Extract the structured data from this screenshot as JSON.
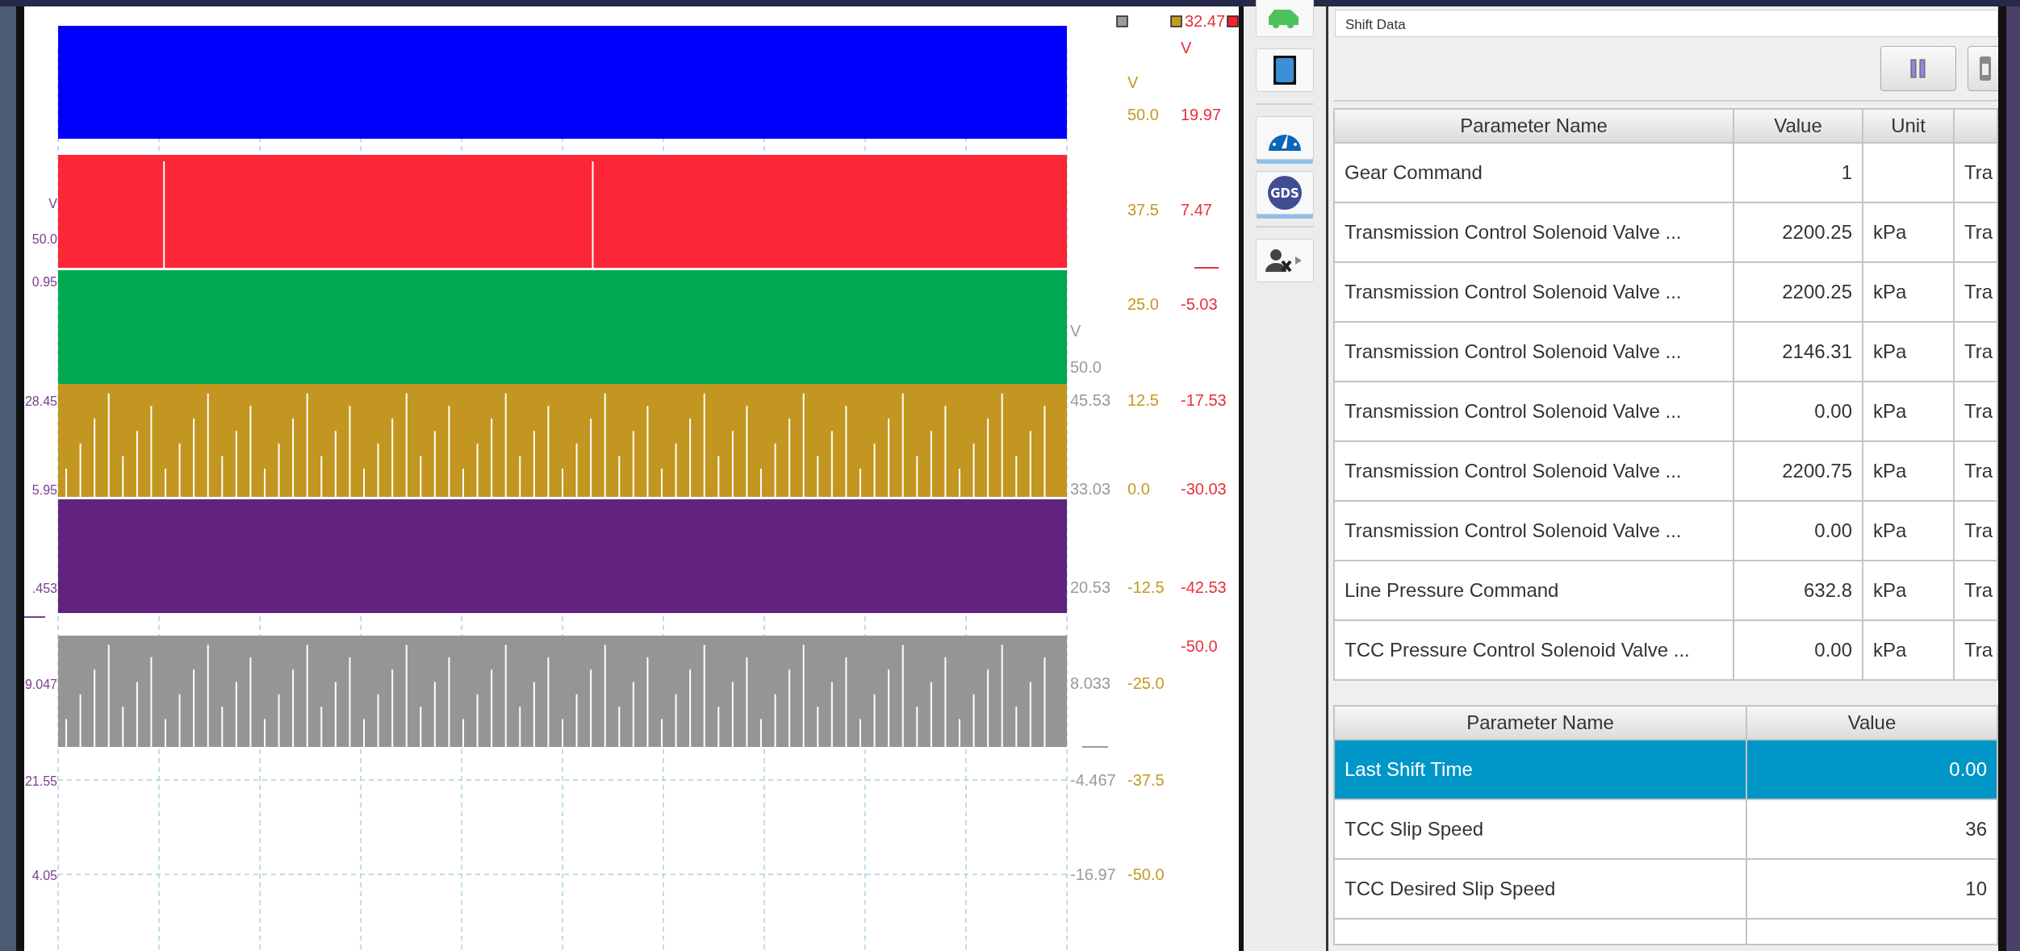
{
  "chart": {
    "legend": [
      {
        "color": "#9a9a9a"
      },
      {
        "color": "#c49a1f"
      },
      {
        "color": "#f0242e"
      }
    ],
    "traces": [
      {
        "color": "#0000ff",
        "kind": "plain"
      },
      {
        "color": "#fb2636",
        "kind": "sparse"
      },
      {
        "color": "#00a84f",
        "kind": "plain"
      },
      {
        "color": "#c29620",
        "kind": "dense"
      },
      {
        "color": "#61237e",
        "kind": "plain"
      },
      {
        "color": "#959595",
        "kind": "dense"
      }
    ],
    "axes": [
      {
        "color": "#7a3f8a",
        "labels": [
          "V",
          "50.0",
          "0.95",
          "28.45",
          "5.95",
          ".453",
          "9.047",
          "21.55",
          "4.05"
        ]
      },
      {
        "color": "#9a9a9a",
        "labels": [
          "V",
          "50.0",
          "45.53",
          "33.03",
          "20.53",
          "8.033",
          "-4.467",
          "-16.97"
        ]
      },
      {
        "color": "#c49a1f",
        "labels": [
          "V",
          "50.0",
          "37.5",
          "25.0",
          "12.5",
          "0.0",
          "-12.5",
          "-25.0",
          "-37.5",
          "-50.0"
        ]
      },
      {
        "color": "#e8303a",
        "labels": [
          "32.47",
          "V",
          "19.97",
          "7.47",
          "-5.03",
          "-17.53",
          "-30.03",
          "-42.53",
          "-50.0"
        ]
      }
    ]
  },
  "sidebar": {
    "buttons": [
      {
        "kind": "car",
        "underlined": false
      },
      {
        "kind": "square",
        "underlined": false
      },
      {
        "kind": "gauge",
        "underlined": true
      },
      {
        "kind": "gds",
        "label": "GDS",
        "underlined": true
      },
      {
        "kind": "user-remove",
        "underlined": false
      }
    ]
  },
  "panel": {
    "title": "Shift Data",
    "table": {
      "columns": [
        "Parameter Name",
        "Value",
        "Unit",
        ""
      ],
      "rows": [
        {
          "selected": false,
          "cells": [
            "Gear Command",
            "1",
            "",
            "Tra"
          ]
        },
        {
          "selected": false,
          "cells": [
            "Transmission Control Solenoid Valve ...",
            "2200.25",
            "kPa",
            "Tra"
          ]
        },
        {
          "selected": false,
          "cells": [
            "Transmission Control Solenoid Valve ...",
            "2200.25",
            "kPa",
            "Tra"
          ]
        },
        {
          "selected": false,
          "cells": [
            "Transmission Control Solenoid Valve ...",
            "2146.31",
            "kPa",
            "Tra"
          ]
        },
        {
          "selected": false,
          "cells": [
            "Transmission Control Solenoid Valve ...",
            "0.00",
            "kPa",
            "Tra"
          ]
        },
        {
          "selected": false,
          "cells": [
            "Transmission Control Solenoid Valve ...",
            "2200.75",
            "kPa",
            "Tra"
          ]
        },
        {
          "selected": false,
          "cells": [
            "Transmission Control Solenoid Valve ...",
            "0.00",
            "kPa",
            "Tra"
          ]
        },
        {
          "selected": false,
          "cells": [
            "Line Pressure Command",
            "632.8",
            "kPa",
            "Tra"
          ]
        },
        {
          "selected": false,
          "cells": [
            "TCC Pressure Control Solenoid Valve ...",
            "0.00",
            "kPa",
            "Tra"
          ]
        }
      ]
    },
    "shift_table": {
      "columns": [
        "Parameter Name",
        "Value"
      ],
      "rows": [
        {
          "selected": true,
          "cells": [
            "Last Shift Time",
            "0.00"
          ]
        },
        {
          "selected": false,
          "cells": [
            "TCC Slip Speed",
            "36"
          ]
        },
        {
          "selected": false,
          "cells": [
            "TCC Desired Slip Speed",
            "10"
          ]
        }
      ]
    }
  }
}
